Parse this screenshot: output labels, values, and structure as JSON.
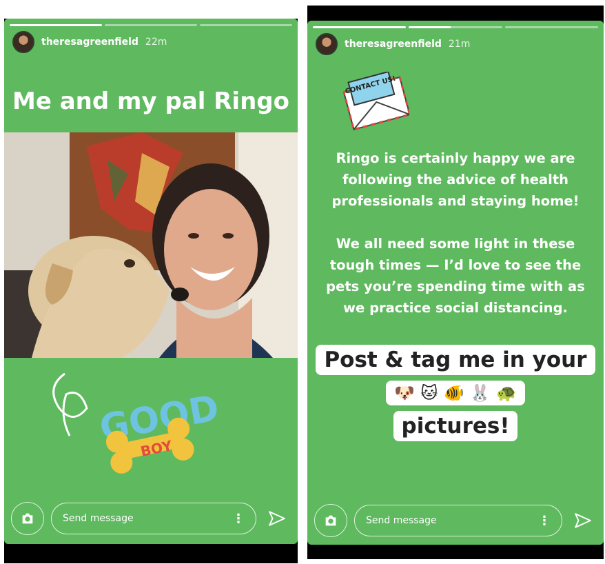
{
  "stories": [
    {
      "username": "theresagreenfield",
      "time": "22m",
      "progress": [
        1.0,
        0.0,
        0.0
      ],
      "title": "Me and my pal Ringo",
      "sticker_word": "GOOD",
      "sticker_tag": "BOY"
    },
    {
      "username": "theresagreenfield",
      "time": "21m",
      "progress": [
        1.0,
        0.45,
        0.0
      ],
      "sticker_label": "CONTACT US!",
      "paragraph_1": "Ringo is certainly happy we are following the advice of health professionals and staying home!",
      "paragraph_2": "We all need some light in these tough times — I’d love to see the pets you’re spending time with as we practice social distancing.",
      "callout_line_1": "Post & tag me in your",
      "callout_emojis": "🐶 🐱 🐠 🐰 🐢",
      "callout_line_3": "pictures!"
    }
  ],
  "footer": {
    "message_placeholder": "Send message"
  },
  "colors": {
    "background": "#5fb95f"
  },
  "icons": [
    "camera-icon",
    "more-dots-icon",
    "send-icon"
  ]
}
